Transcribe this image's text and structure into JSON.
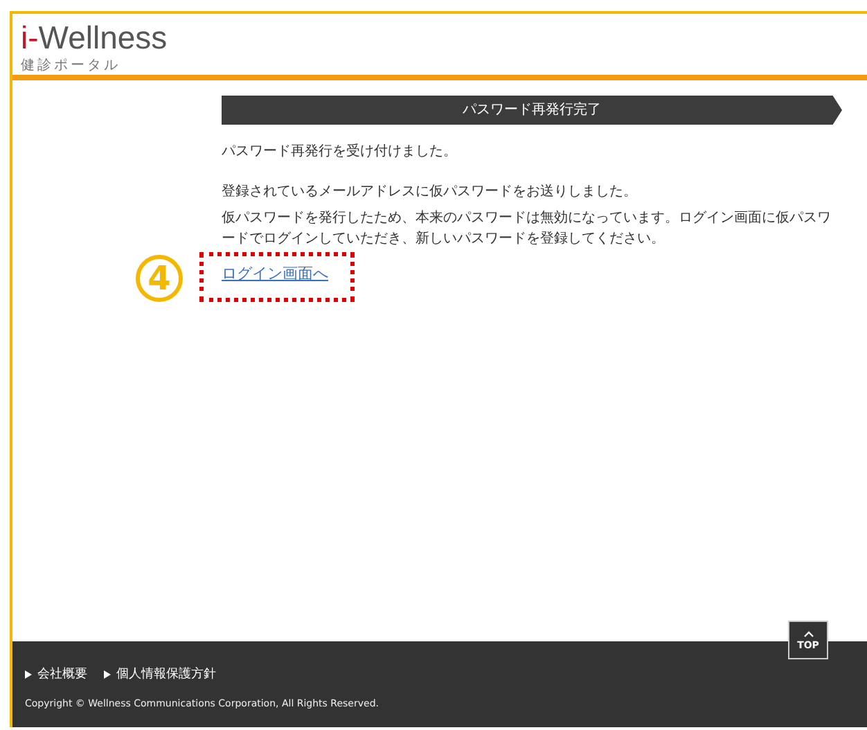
{
  "header": {
    "logo_prefix": "i-",
    "logo_name": "Wellness",
    "logo_subtitle": "健診ポータル"
  },
  "page_title": "パスワード再発行完了",
  "paragraphs": [
    "パスワード再発行を受け付けました。",
    "登録されているメールアドレスに仮パスワードをお送りしました。",
    "仮パスワードを発行したため、本来のパスワードは無効になっています。ログイン画面に仮パスワードでログインしていただき、新しいパスワードを登録してください。"
  ],
  "link": {
    "label": "ログイン画面へ"
  },
  "annotation": {
    "number": "4"
  },
  "top_button": {
    "label": "TOP"
  },
  "footer": {
    "links": [
      "会社概要",
      "個人情報保護方針"
    ],
    "copyright": "Copyright © Wellness Communications Corporation, All Rights Reserved."
  }
}
